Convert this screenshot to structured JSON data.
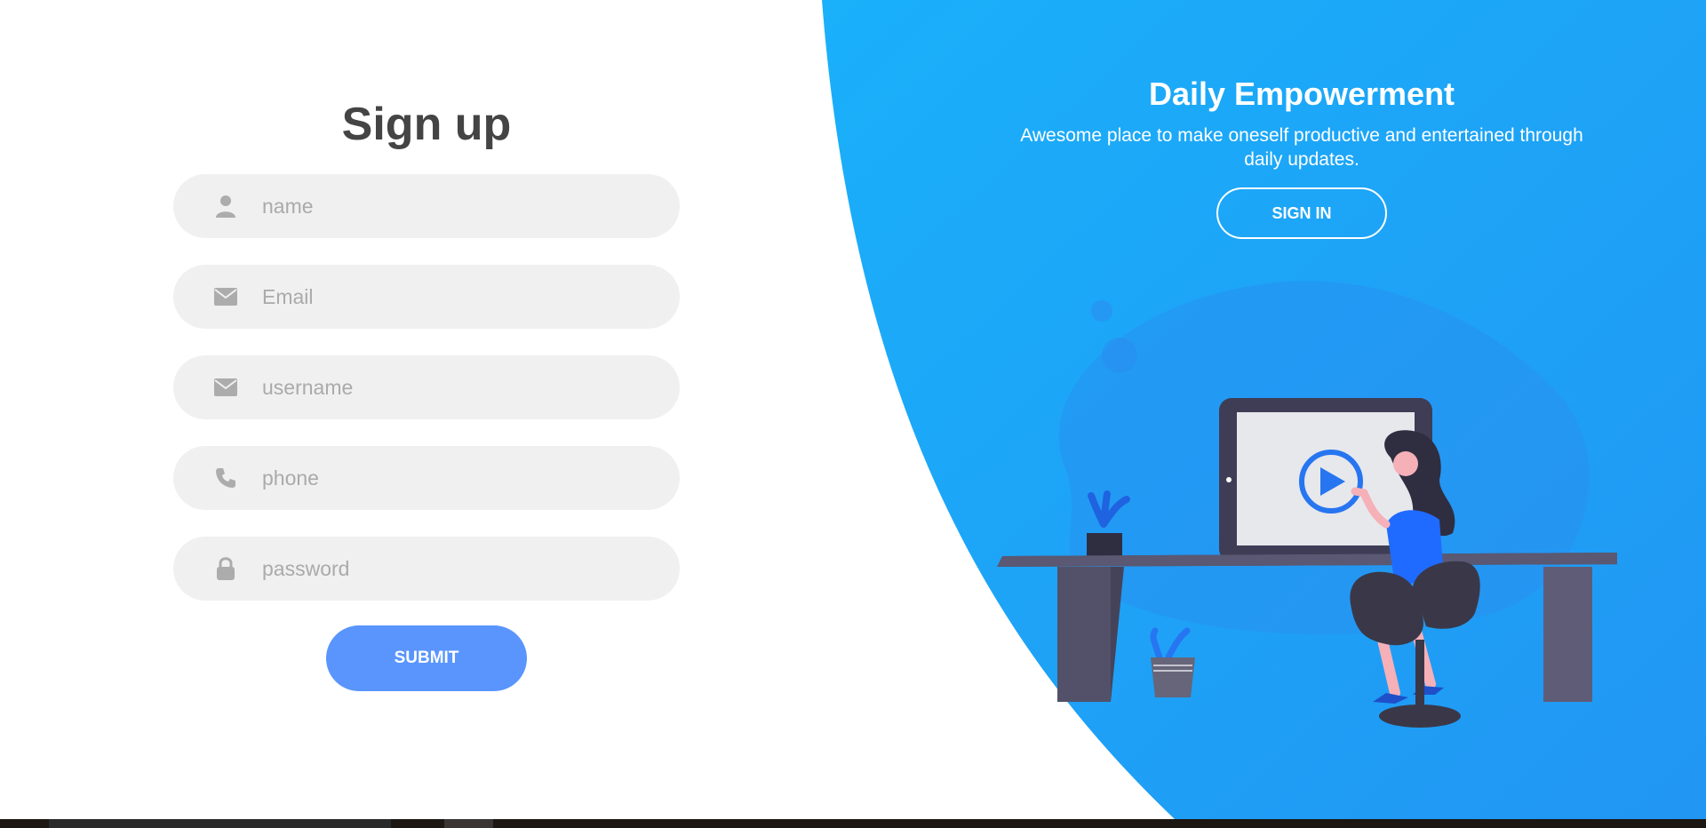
{
  "signup": {
    "title": "Sign up",
    "fields": [
      {
        "placeholder": "name",
        "icon": "user-icon"
      },
      {
        "placeholder": "Email",
        "icon": "envelope-icon"
      },
      {
        "placeholder": "username",
        "icon": "envelope-icon"
      },
      {
        "placeholder": "phone",
        "icon": "phone-icon"
      },
      {
        "placeholder": "password",
        "icon": "lock-icon"
      }
    ],
    "submit_label": "SUBMIT"
  },
  "panel": {
    "heading": "Daily Empowerment",
    "text": "Awesome place to make oneself productive and entertained through daily updates.",
    "signin_label": "SIGN IN"
  },
  "colors": {
    "accent": "#5995fd",
    "panel_start": "#04befe",
    "panel_end": "#4481eb",
    "field_bg": "#f0f0f0",
    "title": "#444444"
  }
}
